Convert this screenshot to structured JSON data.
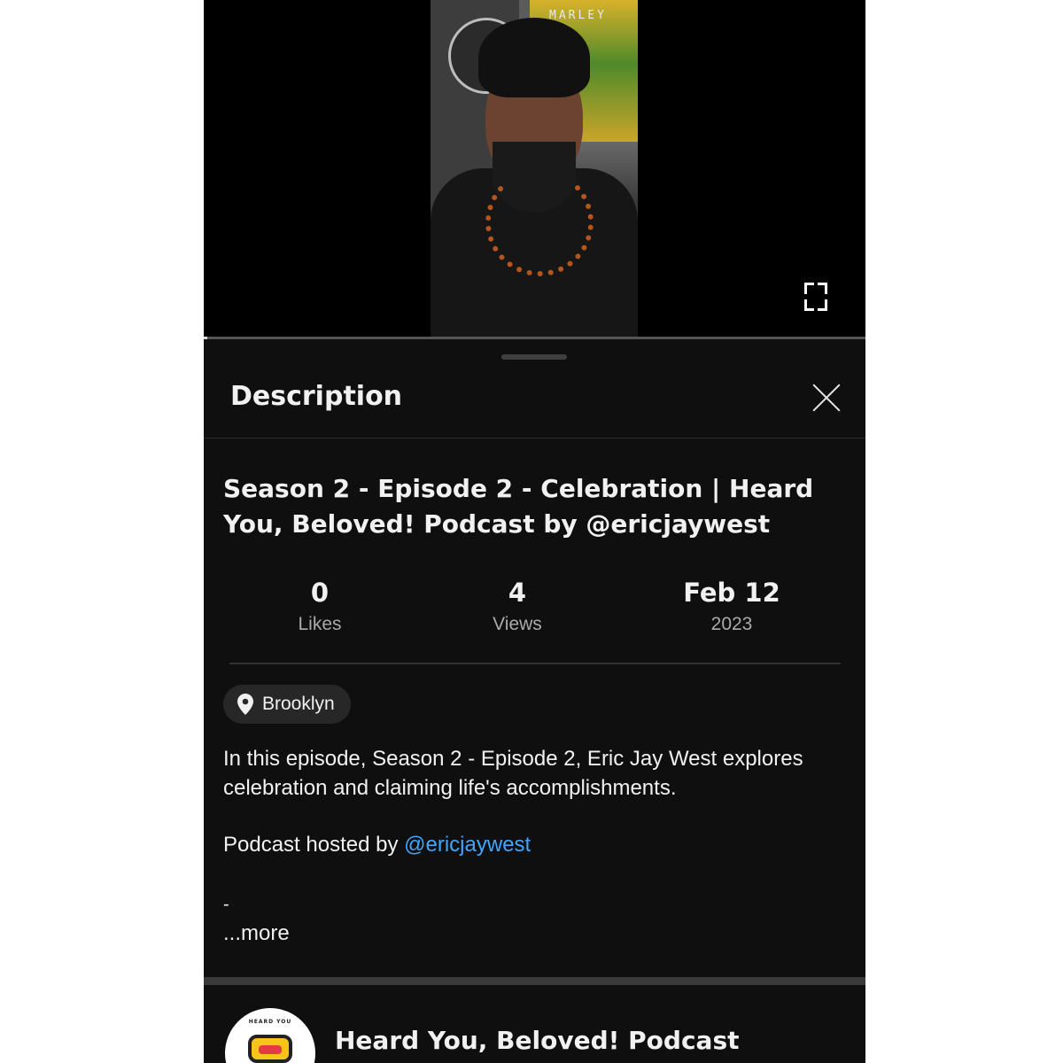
{
  "video": {
    "poster_text": "MARLEY"
  },
  "description_sheet": {
    "title": "Description",
    "video_title": "Season 2 - Episode 2 - Celebration | Heard You, Beloved! Podcast by @ericjaywest",
    "stats": {
      "likes_value": "0",
      "likes_label": "Likes",
      "views_value": "4",
      "views_label": "Views",
      "date_value": "Feb 12",
      "date_label": "2023"
    },
    "location": "Brooklyn",
    "description": "In this episode, Season 2 - Episode 2, Eric Jay West explores celebration and claiming life's accomplishments.",
    "hosted_prefix": "Podcast hosted by ",
    "hosted_link": "@ericjaywest",
    "dash": "-",
    "more_label": "...more"
  },
  "channel": {
    "avatar_text": "HEARD YOU",
    "name": "Heard You, Beloved! Podcast"
  },
  "colors": {
    "background": "#0f0f0f",
    "link": "#3ea6ff",
    "chip": "#272727",
    "secondary_text": "#aaaaaa"
  },
  "icons": [
    "fullscreen-icon",
    "close-icon",
    "location-pin-icon"
  ]
}
